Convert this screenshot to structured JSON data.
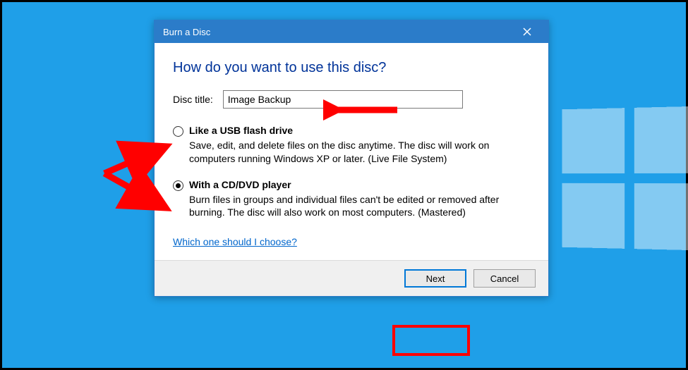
{
  "dialog": {
    "title": "Burn a Disc",
    "headline": "How do you want to use this disc?",
    "disc_title_label": "Disc title:",
    "disc_title_value": "Image Backup",
    "options": [
      {
        "label": "Like a USB flash drive",
        "desc": "Save, edit, and delete files on the disc anytime. The disc will work on computers running Windows XP or later. (Live File System)",
        "selected": false
      },
      {
        "label": "With a CD/DVD player",
        "desc": "Burn files in groups and individual files can't be edited or removed after burning. The disc will also work on most computers. (Mastered)",
        "selected": true
      }
    ],
    "help_link": "Which one should I choose?",
    "buttons": {
      "next": "Next",
      "cancel": "Cancel"
    }
  },
  "annotations": {
    "arrow_color": "#ff0000",
    "highlight_color": "#ff0000"
  }
}
